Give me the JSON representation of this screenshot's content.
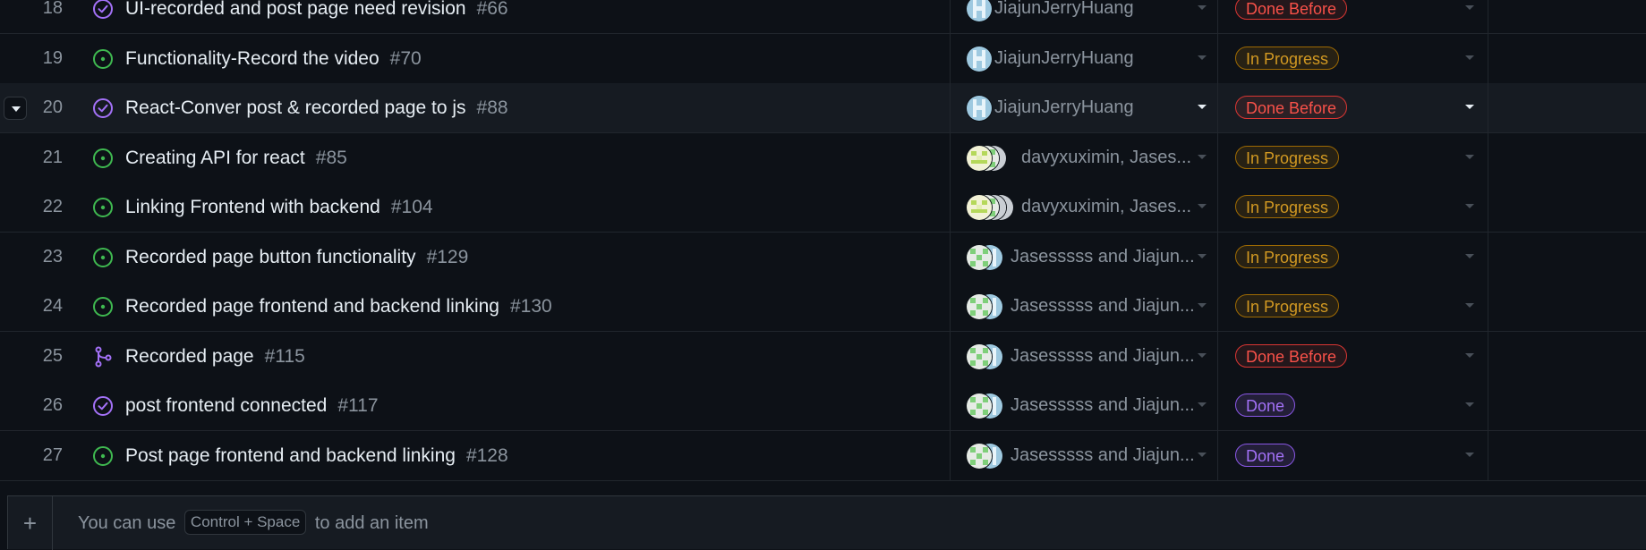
{
  "rows": [
    {
      "num": "18",
      "icon": "closed-issue-icon",
      "title": "UI-recorded and post page need revision",
      "issue": "#66",
      "assignee": "JiajunJerryHuang",
      "status": "Done Before",
      "status_kind": "doneb"
    },
    {
      "num": "19",
      "icon": "open-issue-icon",
      "title": "Functionality-Record the video",
      "issue": "#70",
      "assignee": "JiajunJerryHuang",
      "status": "In Progress",
      "status_kind": "prog"
    },
    {
      "num": "20",
      "icon": "closed-issue-icon",
      "title": "React-Conver post & recorded page to js",
      "issue": "#88",
      "assignee": "JiajunJerryHuang",
      "status": "Done Before",
      "status_kind": "doneb"
    },
    {
      "num": "21",
      "icon": "open-issue-icon",
      "title": "Creating API for react",
      "issue": "#85",
      "assignee": "davyxuximin, Jases...",
      "status": "In Progress",
      "status_kind": "prog"
    },
    {
      "num": "22",
      "icon": "open-issue-icon",
      "title": "Linking Frontend with backend",
      "issue": "#104",
      "assignee": "davyxuximin, Jases...",
      "status": "In Progress",
      "status_kind": "prog"
    },
    {
      "num": "23",
      "icon": "open-issue-icon",
      "title": "Recorded page button functionality",
      "issue": "#129",
      "assignee": "Jasesssss and Jiajun...",
      "status": "In Progress",
      "status_kind": "prog"
    },
    {
      "num": "24",
      "icon": "open-issue-icon",
      "title": "Recorded page frontend and backend linking",
      "issue": "#130",
      "assignee": "Jasesssss and Jiajun...",
      "status": "In Progress",
      "status_kind": "prog"
    },
    {
      "num": "25",
      "icon": "merged-pr-icon",
      "title": "Recorded page",
      "issue": "#115",
      "assignee": "Jasesssss and Jiajun...",
      "status": "Done Before",
      "status_kind": "doneb"
    },
    {
      "num": "26",
      "icon": "closed-issue-icon",
      "title": "post frontend connected",
      "issue": "#117",
      "assignee": "Jasesssss and Jiajun...",
      "status": "Done",
      "status_kind": "done"
    },
    {
      "num": "27",
      "icon": "open-issue-icon",
      "title": "Post page frontend and backend linking",
      "issue": "#128",
      "assignee": "Jasesssss and Jiajun...",
      "status": "Done",
      "status_kind": "done"
    }
  ],
  "footer": {
    "hint_before": "You can use",
    "shortcut": "Control + Space",
    "hint_after": "to add an item"
  },
  "colors": {
    "open": "#3fb950",
    "closed": "#a371f7",
    "merged": "#a371f7"
  }
}
